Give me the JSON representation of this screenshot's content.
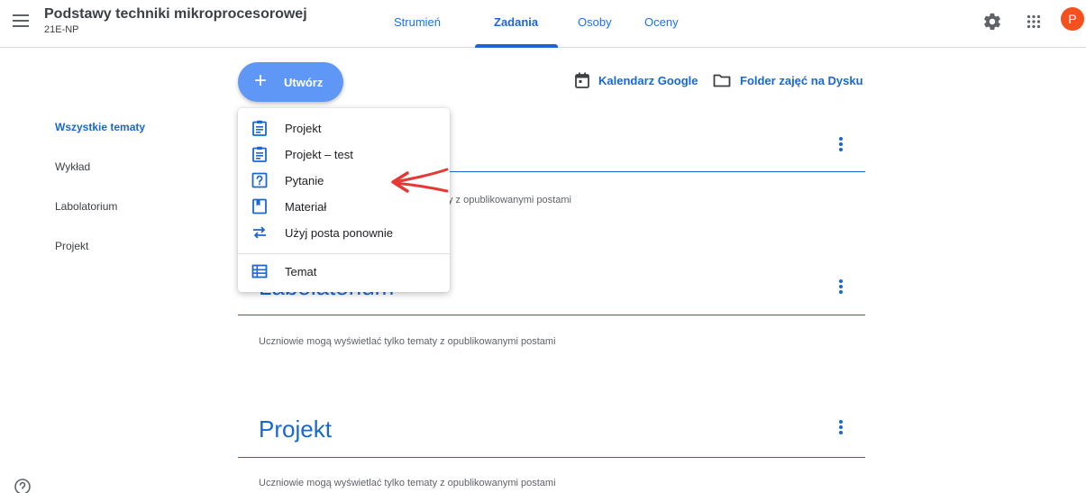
{
  "header": {
    "class_title": "Podstawy techniki mikroprocesorowej",
    "class_section": "21E-NP",
    "tabs": [
      {
        "label": "Strumień",
        "active": false
      },
      {
        "label": "Zadania",
        "active": true
      },
      {
        "label": "Osoby",
        "active": false
      },
      {
        "label": "Oceny",
        "active": false
      }
    ],
    "avatar_letter": "P"
  },
  "toolbar": {
    "create_label": "Utwórz",
    "calendar_label": "Kalendarz Google",
    "drive_label": "Folder zajęć na Dysku"
  },
  "sidebar": {
    "items": [
      {
        "label": "Wszystkie tematy",
        "active": true
      },
      {
        "label": "Wykład",
        "active": false
      },
      {
        "label": "Labolatorium",
        "active": false
      },
      {
        "label": "Projekt",
        "active": false
      }
    ]
  },
  "create_menu": {
    "items": [
      {
        "label": "Projekt",
        "icon": "assignment-icon"
      },
      {
        "label": "Projekt – test",
        "icon": "quiz-assignment-icon"
      },
      {
        "label": "Pytanie",
        "icon": "question-icon"
      },
      {
        "label": "Materiał",
        "icon": "material-icon"
      },
      {
        "label": "Użyj posta ponownie",
        "icon": "reuse-icon"
      }
    ],
    "topic_label": "Temat",
    "topic_icon": "topic-icon"
  },
  "topics": [
    {
      "title": "",
      "note": "y z opublikowanymi postami"
    },
    {
      "title": "Labolatorium",
      "note": "Uczniowie mogą wyświetlać tylko tematy z opublikowanymi postami"
    },
    {
      "title": "Projekt",
      "note": "Uczniowie mogą wyświetlać tylko tematy z opublikowanymi postami"
    }
  ],
  "colors": {
    "accent": "#1967d2",
    "create_button": "#5e97f6",
    "avatar": "#f4511e",
    "annotation_arrow": "#e53935"
  }
}
